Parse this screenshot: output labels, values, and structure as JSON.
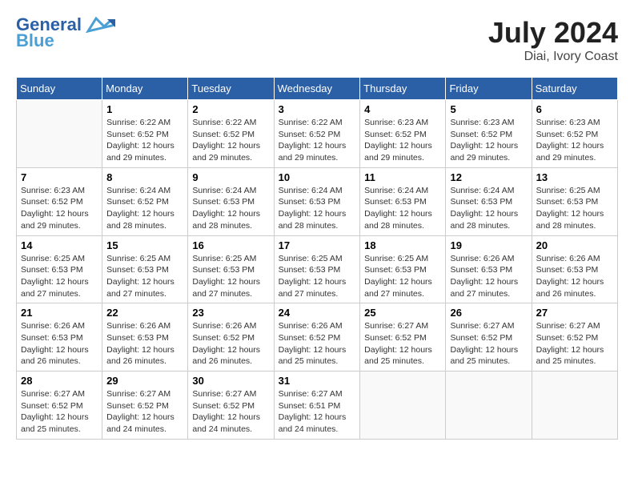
{
  "header": {
    "logo_line1": "General",
    "logo_line2": "Blue",
    "month": "July 2024",
    "location": "Diai, Ivory Coast"
  },
  "days_of_week": [
    "Sunday",
    "Monday",
    "Tuesday",
    "Wednesday",
    "Thursday",
    "Friday",
    "Saturday"
  ],
  "weeks": [
    [
      {
        "day": "",
        "info": ""
      },
      {
        "day": "1",
        "info": "Sunrise: 6:22 AM\nSunset: 6:52 PM\nDaylight: 12 hours\nand 29 minutes."
      },
      {
        "day": "2",
        "info": "Sunrise: 6:22 AM\nSunset: 6:52 PM\nDaylight: 12 hours\nand 29 minutes."
      },
      {
        "day": "3",
        "info": "Sunrise: 6:22 AM\nSunset: 6:52 PM\nDaylight: 12 hours\nand 29 minutes."
      },
      {
        "day": "4",
        "info": "Sunrise: 6:23 AM\nSunset: 6:52 PM\nDaylight: 12 hours\nand 29 minutes."
      },
      {
        "day": "5",
        "info": "Sunrise: 6:23 AM\nSunset: 6:52 PM\nDaylight: 12 hours\nand 29 minutes."
      },
      {
        "day": "6",
        "info": "Sunrise: 6:23 AM\nSunset: 6:52 PM\nDaylight: 12 hours\nand 29 minutes."
      }
    ],
    [
      {
        "day": "7",
        "info": "Sunrise: 6:23 AM\nSunset: 6:52 PM\nDaylight: 12 hours\nand 29 minutes."
      },
      {
        "day": "8",
        "info": "Sunrise: 6:24 AM\nSunset: 6:52 PM\nDaylight: 12 hours\nand 28 minutes."
      },
      {
        "day": "9",
        "info": "Sunrise: 6:24 AM\nSunset: 6:53 PM\nDaylight: 12 hours\nand 28 minutes."
      },
      {
        "day": "10",
        "info": "Sunrise: 6:24 AM\nSunset: 6:53 PM\nDaylight: 12 hours\nand 28 minutes."
      },
      {
        "day": "11",
        "info": "Sunrise: 6:24 AM\nSunset: 6:53 PM\nDaylight: 12 hours\nand 28 minutes."
      },
      {
        "day": "12",
        "info": "Sunrise: 6:24 AM\nSunset: 6:53 PM\nDaylight: 12 hours\nand 28 minutes."
      },
      {
        "day": "13",
        "info": "Sunrise: 6:25 AM\nSunset: 6:53 PM\nDaylight: 12 hours\nand 28 minutes."
      }
    ],
    [
      {
        "day": "14",
        "info": "Sunrise: 6:25 AM\nSunset: 6:53 PM\nDaylight: 12 hours\nand 27 minutes."
      },
      {
        "day": "15",
        "info": "Sunrise: 6:25 AM\nSunset: 6:53 PM\nDaylight: 12 hours\nand 27 minutes."
      },
      {
        "day": "16",
        "info": "Sunrise: 6:25 AM\nSunset: 6:53 PM\nDaylight: 12 hours\nand 27 minutes."
      },
      {
        "day": "17",
        "info": "Sunrise: 6:25 AM\nSunset: 6:53 PM\nDaylight: 12 hours\nand 27 minutes."
      },
      {
        "day": "18",
        "info": "Sunrise: 6:25 AM\nSunset: 6:53 PM\nDaylight: 12 hours\nand 27 minutes."
      },
      {
        "day": "19",
        "info": "Sunrise: 6:26 AM\nSunset: 6:53 PM\nDaylight: 12 hours\nand 27 minutes."
      },
      {
        "day": "20",
        "info": "Sunrise: 6:26 AM\nSunset: 6:53 PM\nDaylight: 12 hours\nand 26 minutes."
      }
    ],
    [
      {
        "day": "21",
        "info": "Sunrise: 6:26 AM\nSunset: 6:53 PM\nDaylight: 12 hours\nand 26 minutes."
      },
      {
        "day": "22",
        "info": "Sunrise: 6:26 AM\nSunset: 6:53 PM\nDaylight: 12 hours\nand 26 minutes."
      },
      {
        "day": "23",
        "info": "Sunrise: 6:26 AM\nSunset: 6:52 PM\nDaylight: 12 hours\nand 26 minutes."
      },
      {
        "day": "24",
        "info": "Sunrise: 6:26 AM\nSunset: 6:52 PM\nDaylight: 12 hours\nand 25 minutes."
      },
      {
        "day": "25",
        "info": "Sunrise: 6:27 AM\nSunset: 6:52 PM\nDaylight: 12 hours\nand 25 minutes."
      },
      {
        "day": "26",
        "info": "Sunrise: 6:27 AM\nSunset: 6:52 PM\nDaylight: 12 hours\nand 25 minutes."
      },
      {
        "day": "27",
        "info": "Sunrise: 6:27 AM\nSunset: 6:52 PM\nDaylight: 12 hours\nand 25 minutes."
      }
    ],
    [
      {
        "day": "28",
        "info": "Sunrise: 6:27 AM\nSunset: 6:52 PM\nDaylight: 12 hours\nand 25 minutes."
      },
      {
        "day": "29",
        "info": "Sunrise: 6:27 AM\nSunset: 6:52 PM\nDaylight: 12 hours\nand 24 minutes."
      },
      {
        "day": "30",
        "info": "Sunrise: 6:27 AM\nSunset: 6:52 PM\nDaylight: 12 hours\nand 24 minutes."
      },
      {
        "day": "31",
        "info": "Sunrise: 6:27 AM\nSunset: 6:51 PM\nDaylight: 12 hours\nand 24 minutes."
      },
      {
        "day": "",
        "info": ""
      },
      {
        "day": "",
        "info": ""
      },
      {
        "day": "",
        "info": ""
      }
    ]
  ]
}
